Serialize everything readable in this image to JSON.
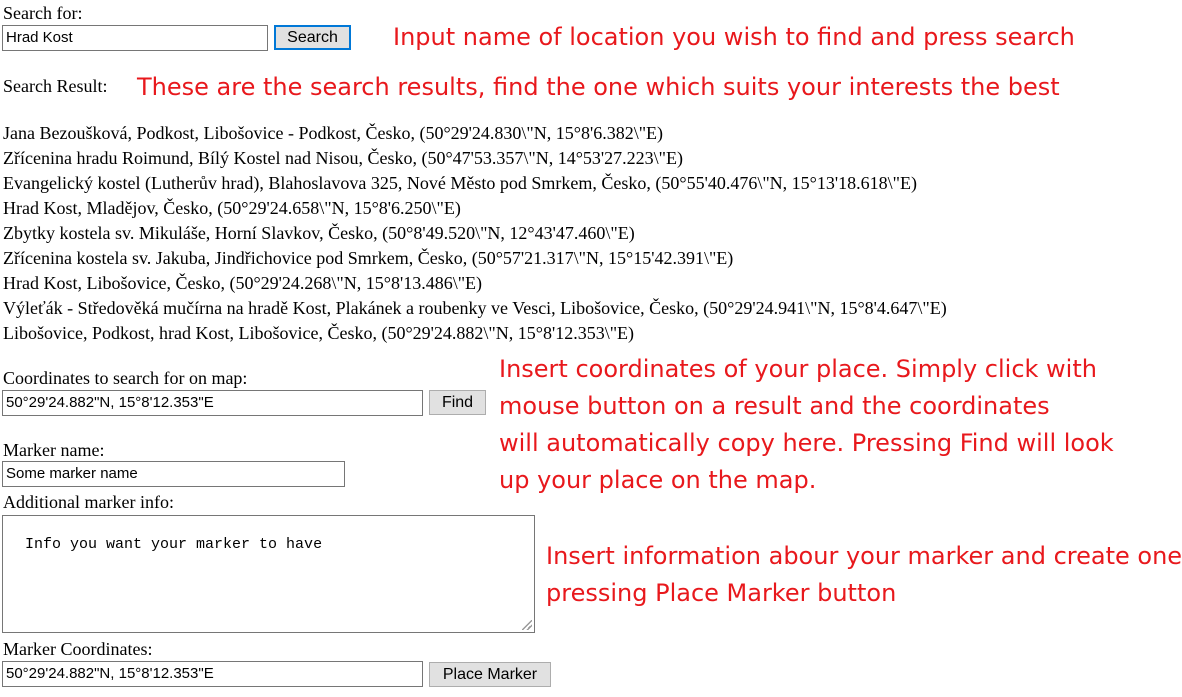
{
  "search": {
    "label": "Search for:",
    "value": "Hrad Kost",
    "button": "Search"
  },
  "search_result_label": "Search Result:",
  "results": [
    "Jana Bezoušková, Podkost, Libošovice - Podkost, Česko, (50°29'24.830\\\"N, 15°8'6.382\\\"E)",
    "Zřícenina hradu Roimund, Bílý Kostel nad Nisou, Česko, (50°47'53.357\\\"N, 14°53'27.223\\\"E)",
    "Evangelický kostel (Lutherův hrad), Blahoslavova 325, Nové Město pod Smrkem, Česko, (50°55'40.476\\\"N, 15°13'18.618\\\"E)",
    "Hrad Kost, Mladějov, Česko, (50°29'24.658\\\"N, 15°8'6.250\\\"E)",
    "Zbytky kostela sv. Mikuláše, Horní Slavkov, Česko, (50°8'49.520\\\"N, 12°43'47.460\\\"E)",
    "Zřícenina kostela sv. Jakuba, Jindřichovice pod Smrkem, Česko, (50°57'21.317\\\"N, 15°15'42.391\\\"E)",
    "Hrad Kost, Libošovice, Česko, (50°29'24.268\\\"N, 15°8'13.486\\\"E)",
    "Výleťák - Středověká mučírna na hradě Kost, Plakánek a roubenky ve Vesci, Libošovice, Česko, (50°29'24.941\\\"N, 15°8'4.647\\\"E)",
    "Libošovice, Podkost, hrad Kost, Libošovice, Česko, (50°29'24.882\\\"N, 15°8'12.353\\\"E)"
  ],
  "coords": {
    "label": "Coordinates to search for on map:",
    "value": "50°29'24.882\"N, 15°8'12.353\"E",
    "button": "Find"
  },
  "marker": {
    "name_label": "Marker name:",
    "name_value": "Some marker name",
    "info_label": "Additional marker info:",
    "info_value": "Info you want your marker to have",
    "coords_label": "Marker Coordinates:",
    "coords_value": "50°29'24.882\"N, 15°8'12.353\"E",
    "button": "Place Marker"
  },
  "annotations": {
    "search": "Input name of location you wish to find and press search",
    "results": "These are the search results, find the one which suits your interests the best",
    "coords_lines": [
      "Insert coordinates of your place. Simply click with",
      "mouse button on a result and the coordinates",
      "will automatically copy here. Pressing Find will look",
      "up your place on the map."
    ],
    "marker_lines": [
      "Insert information abour your marker and create one",
      "pressing Place Marker button"
    ]
  },
  "colors": {
    "annotation": "#e8181c",
    "focus_border": "#0078d7",
    "button_bg": "#e1e1e1"
  }
}
